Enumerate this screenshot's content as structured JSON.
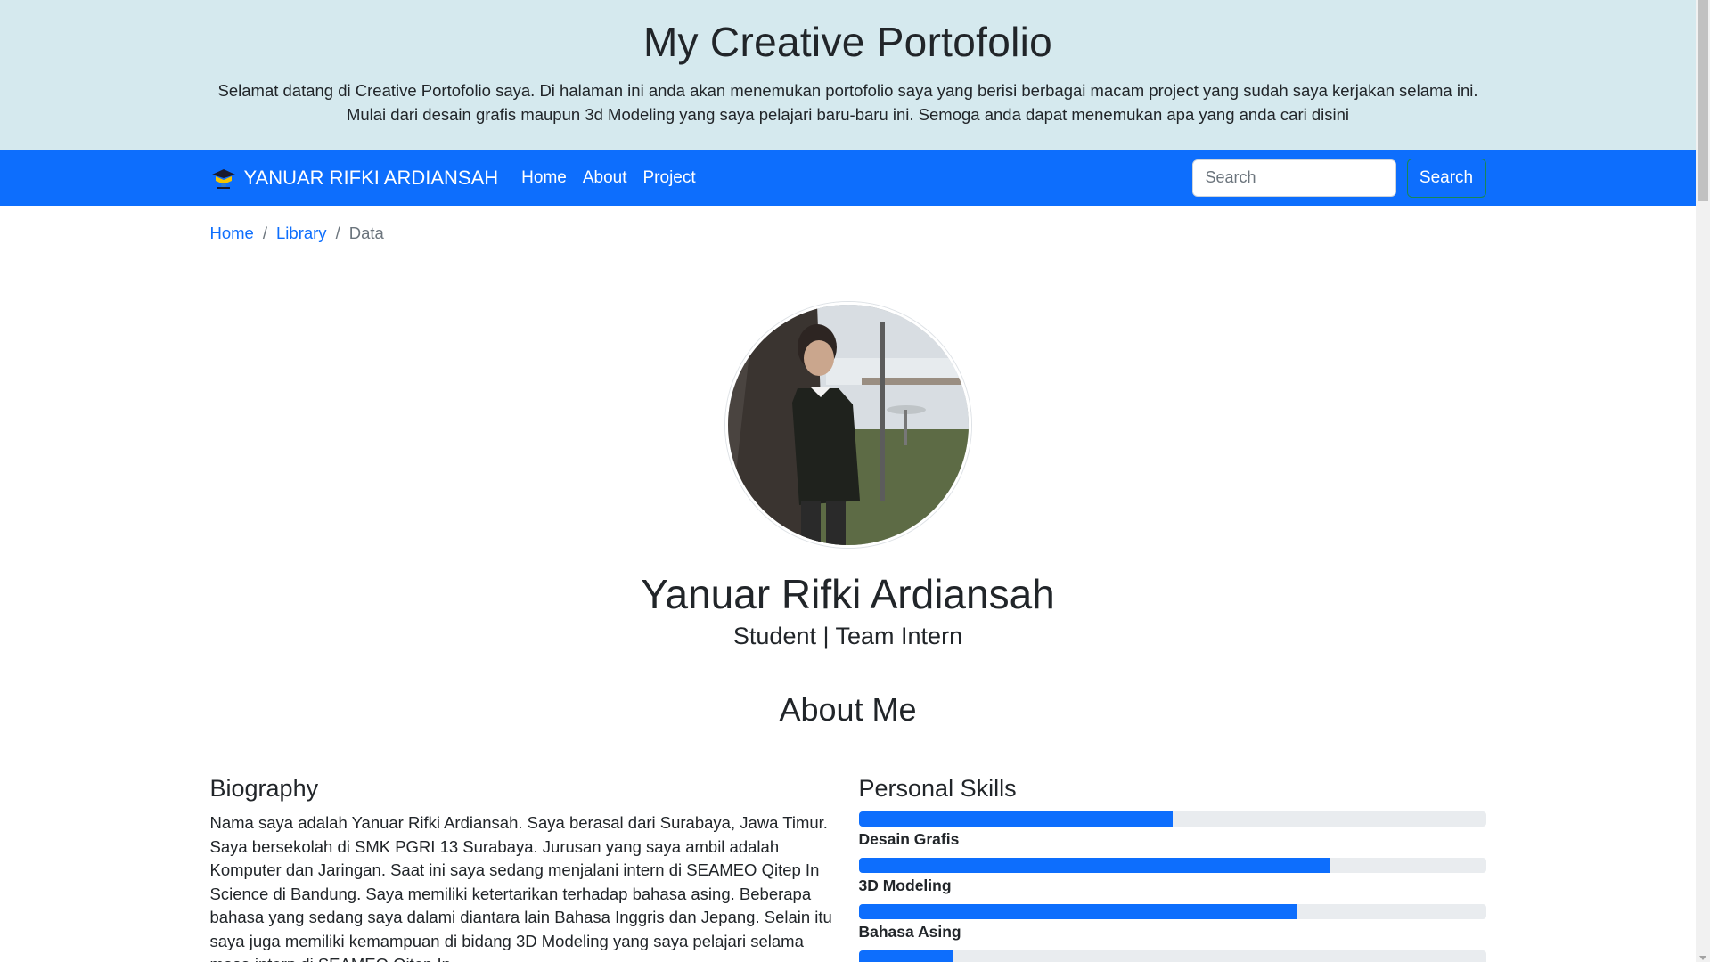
{
  "hero": {
    "title": "My Creative Portofolio",
    "subtitle": "Selamat datang di Creative Portofolio saya. Di halaman ini anda akan menemukan portofolio saya yang berisi berbagai macam project yang sudah saya kerjakan selama ini. Mulai dari desain grafis maupun 3d Modeling yang saya pelajari baru-baru ini. Semoga anda dapat menemukan apa yang anda cari disini"
  },
  "navbar": {
    "brand": "YANUAR RIFKI ARDIANSAH",
    "links": [
      "Home",
      "About",
      "Project"
    ],
    "search_placeholder": "Search",
    "search_button": "Search",
    "bg_color": "#0d6efd"
  },
  "breadcrumb": {
    "items": [
      "Home",
      "Library"
    ],
    "current": "Data"
  },
  "profile": {
    "name": "Yanuar Rifki Ardiansah",
    "role": "Student | Team Intern"
  },
  "about": {
    "title": "About Me",
    "biography_title": "Biography",
    "biography_text": "Nama saya adalah Yanuar Rifki Ardiansah. Saya berasal dari Surabaya, Jawa Timur. Saya bersekolah di SMK PGRI 13 Surabaya. Jurusan yang saya ambil adalah Komputer dan Jaringan. Saat ini saya sedang menjalani intern di SEAMEO Qitep In Science di Bandung. Saya memiliki ketertarikan terhadap bahasa asing. Beberapa bahasa yang sedang saya dalami diantara lain Bahasa Inggris dan Jepang. Selain itu saya juga memiliki kemampuan di bidang 3D Modeling yang saya pelajari selama masa intern di SEAMEO Qitep In",
    "skills_title": "Personal Skills",
    "skills": [
      {
        "label": "Desain Grafis",
        "percent": 50
      },
      {
        "label": "3D Modeling",
        "percent": 75
      },
      {
        "label": "Bahasa Asing",
        "percent": 70
      },
      {
        "label": "",
        "percent": 15
      }
    ]
  }
}
